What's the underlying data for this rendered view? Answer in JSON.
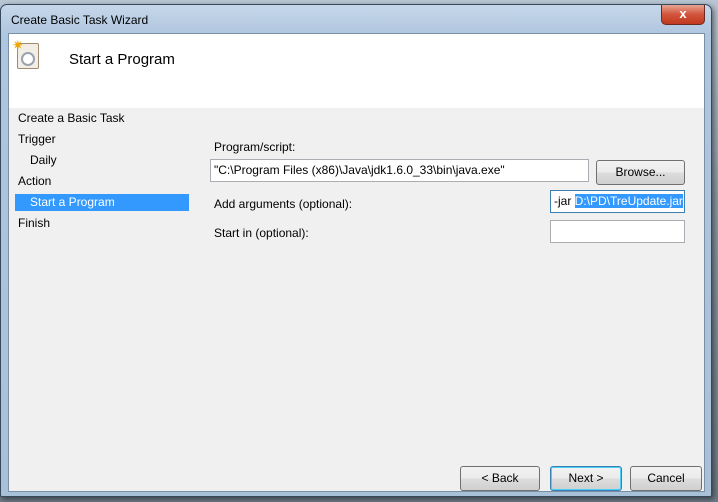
{
  "window": {
    "title": "Create Basic Task Wizard",
    "close_label": "x"
  },
  "header": {
    "title": "Start a Program",
    "icon": "task-clock-icon"
  },
  "nav": {
    "items": [
      {
        "label": "Create a Basic Task",
        "indent": false,
        "selected": false
      },
      {
        "label": "Trigger",
        "indent": false,
        "selected": false
      },
      {
        "label": "Daily",
        "indent": true,
        "selected": false
      },
      {
        "label": "Action",
        "indent": false,
        "selected": false
      },
      {
        "label": "Start a Program",
        "indent": true,
        "selected": true
      },
      {
        "label": "Finish",
        "indent": false,
        "selected": false
      }
    ]
  },
  "form": {
    "program_label": "Program/script:",
    "program_value": "\"C:\\Program Files (x86)\\Java\\jdk1.6.0_33\\bin\\java.exe\"",
    "browse_label": "Browse...",
    "args_label": "Add arguments (optional):",
    "args_value_plain": "-jar ",
    "args_value_selected": "D:\\PD\\TreUpdate.jar",
    "startin_label": "Start in (optional):",
    "startin_value": ""
  },
  "buttons": {
    "back": "< Back",
    "next": "Next >",
    "cancel": "Cancel"
  }
}
